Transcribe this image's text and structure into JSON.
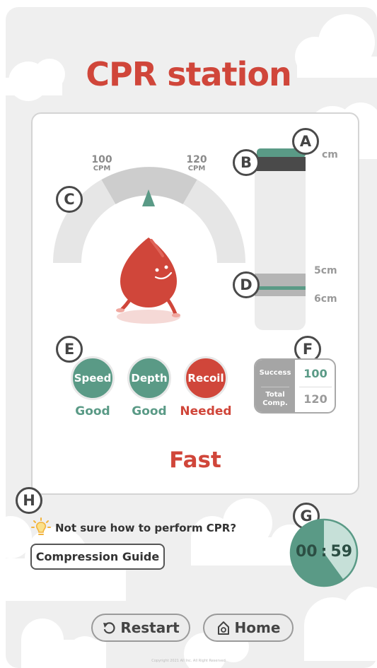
{
  "page": {
    "title": "CPR station"
  },
  "speed_gauge": {
    "low_value": "100",
    "low_unit": "CPM",
    "high_value": "120",
    "high_unit": "CPM"
  },
  "depth_meter": {
    "top_label": "cm",
    "label_5cm": "5cm",
    "label_6cm": "6cm"
  },
  "markers": {
    "a": "A",
    "b": "B",
    "c": "C",
    "d": "D",
    "e": "E",
    "f": "F",
    "g": "G",
    "h": "H"
  },
  "metrics": [
    {
      "label": "Speed",
      "status": "Good",
      "color": "#5a9a86"
    },
    {
      "label": "Depth",
      "status": "Good",
      "color": "#5a9a86"
    },
    {
      "label": "Recoil",
      "status": "Needed",
      "color": "#d0463a"
    }
  ],
  "stats": {
    "success_label": "Success",
    "success_value": "100",
    "total_label_1": "Total",
    "total_label_2": "Comp.",
    "total_value": "120"
  },
  "feedback": "Fast",
  "help": {
    "icon": "lightbulb-icon",
    "text": "Not sure how to perform CPR?",
    "button_label": "Compression Guide"
  },
  "timer": {
    "minutes": "00",
    "seconds": "59",
    "separator": ":",
    "progress_fraction": 0.6
  },
  "footer": {
    "restart_label": "Restart",
    "restart_icon": "restart-icon",
    "home_label": "Home",
    "home_icon": "home-icon",
    "copyright": "Copyright 2021 All Inc. All Right Reserved"
  },
  "colors": {
    "brand_red": "#d0463a",
    "good_green": "#5a9a86",
    "timer_dark": "#5a9a86",
    "timer_light": "#c6e0d8"
  }
}
